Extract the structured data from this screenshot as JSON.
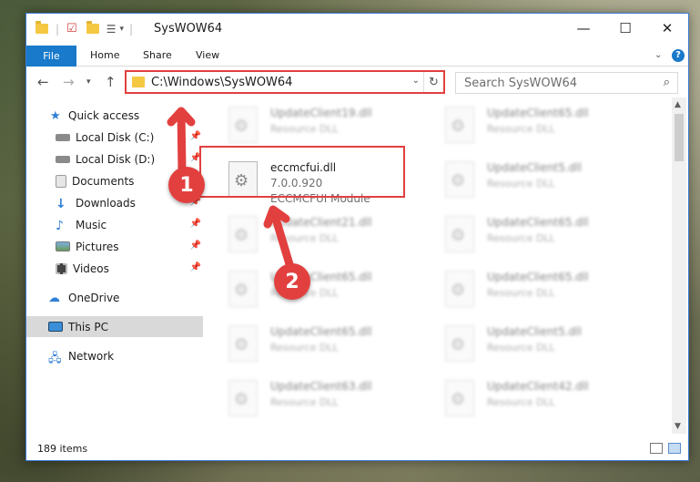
{
  "window": {
    "title": "SysWOW64",
    "minimize_glyph": "—",
    "maximize_glyph": "☐",
    "close_glyph": "✕"
  },
  "ribbon": {
    "tabs": [
      "File",
      "Home",
      "Share",
      "View"
    ],
    "help": "?"
  },
  "address": {
    "path": "C:\\Windows\\SysWOW64"
  },
  "search": {
    "placeholder": "Search SysWOW64"
  },
  "sidebar": {
    "items": [
      {
        "label": "Quick access",
        "icon": "star-icon",
        "pinned": false
      },
      {
        "label": "Local Disk (C:)",
        "icon": "drive-icon",
        "pinned": true
      },
      {
        "label": "Local Disk (D:)",
        "icon": "drive-icon",
        "pinned": true
      },
      {
        "label": "Documents",
        "icon": "documents-icon",
        "pinned": true
      },
      {
        "label": "Downloads",
        "icon": "download-icon",
        "pinned": true
      },
      {
        "label": "Music",
        "icon": "music-icon",
        "pinned": true
      },
      {
        "label": "Pictures",
        "icon": "pictures-icon",
        "pinned": true
      },
      {
        "label": "Videos",
        "icon": "videos-icon",
        "pinned": true
      },
      {
        "label": "OneDrive",
        "icon": "cloud-icon",
        "pinned": false
      },
      {
        "label": "This PC",
        "icon": "computer-icon",
        "pinned": false,
        "selected": true
      },
      {
        "label": "Network",
        "icon": "network-icon",
        "pinned": false
      }
    ]
  },
  "files": {
    "highlighted": {
      "name": "eccmcfui.dll",
      "version": "7.0.0.920",
      "description": "ECCMCFUI Module"
    },
    "left_column": [
      {
        "name": "UpdateClient19.dll",
        "type": "Resource DLL"
      },
      {
        "name": "UpdateClient21.dll",
        "type": "Resource DLL"
      },
      {
        "name": "UpdateClient65.dll",
        "type": "Resource DLL"
      },
      {
        "name": "UpdateClient65.dll",
        "type": "Resource DLL"
      },
      {
        "name": "UpdateClient63.dll",
        "type": "Resource DLL"
      }
    ],
    "right_column": [
      {
        "name": "UpdateClient65.dll",
        "type": "Resource DLL"
      },
      {
        "name": "UpdateClient5.dll",
        "type": "Resource DLL"
      },
      {
        "name": "UpdateClient65.dll",
        "type": "Resource DLL"
      },
      {
        "name": "UpdateClient65.dll",
        "type": "Resource DLL"
      },
      {
        "name": "UpdateClient5.dll",
        "type": "Resource DLL"
      },
      {
        "name": "UpdateClient42.dll",
        "type": "Resource DLL"
      }
    ]
  },
  "status": {
    "item_count": "189 items"
  },
  "annotations": {
    "badge_1": "1",
    "badge_2": "2",
    "color": "#e2403f"
  }
}
